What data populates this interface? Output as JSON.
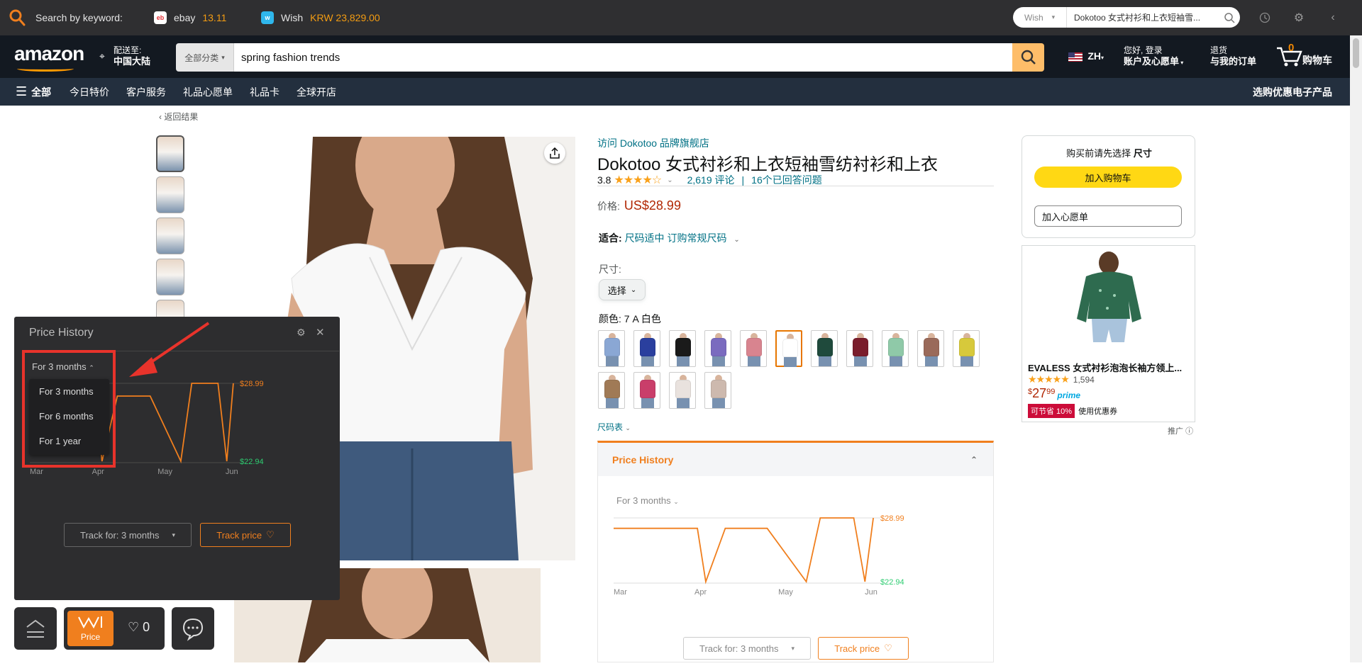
{
  "ext_bar": {
    "search_label": "Search by keyword:",
    "ebay": {
      "name": "ebay",
      "price": "13.11"
    },
    "wish": {
      "name": "Wish",
      "price": "KRW 23,829.00"
    },
    "search": {
      "select": "Wish",
      "query": "Dokotoo 女式衬衫和上衣短袖雪..."
    }
  },
  "header": {
    "logo": "amazon",
    "deliver_line1": "配送至:",
    "deliver_line2": "中国大陆",
    "search_category": "全部分类",
    "search_query": "spring fashion trends",
    "lang": "ZH",
    "account_line1": "您好, 登录",
    "account_line2": "账户及心愿单",
    "orders_line1": "退货",
    "orders_line2": "与我的订单",
    "cart_count": "0",
    "cart_label": "购物车"
  },
  "subnav": {
    "all": "全部",
    "items": [
      "今日特价",
      "客户服务",
      "礼品心愿单",
      "礼品卡",
      "全球开店"
    ],
    "right": "选购优惠电子产品"
  },
  "breadcrumb": "‹ 返回结果",
  "product": {
    "brand_link": "访问 Dokotoo 品牌旗舰店",
    "title": "Dokotoo 女式衬衫和上衣短袖雪纺衬衫和上衣",
    "rating": "3.8",
    "reviews": "2,619 评论",
    "answered": "16个已回答问题",
    "price_label": "价格:",
    "price": "US$28.99",
    "fit_label": "适合:",
    "fit_value": "尺码适中 订购常规尺码",
    "size_label": "尺寸:",
    "size_select": "选择",
    "color_label": "颜色: 7 A 白色",
    "size_chart": "尺码表",
    "swatch_colors": [
      "#8aa7d4",
      "#2a3f9e",
      "#1a1a1a",
      "#7a6bbf",
      "#d8848f",
      "#ffffff",
      "#1f4a3c",
      "#7a1d2c",
      "#8fc9a8",
      "#9a6a5a",
      "#d7c93b",
      "#a07a56",
      "#c93e6a",
      "#e9e2de",
      "#cdb9ae"
    ]
  },
  "buybox": {
    "prompt_prefix": "购买前请先选择",
    "prompt_bold": "尺寸",
    "add_cart": "加入购物车",
    "add_wishlist": "加入心愿单"
  },
  "ad": {
    "title": "EVALESS 女式衬衫泡泡长袖方领上...",
    "rating_count": "1,594",
    "price_symbol": "$",
    "price_whole": "27",
    "price_frac": "99",
    "prime": "prime",
    "coupon_badge": "可节省 10%",
    "coupon_text": "使用优惠券",
    "sponsored": "推广"
  },
  "price_history_inline": {
    "header": "Price History",
    "range": "For 3 months",
    "max_label": "$28.99",
    "min_label": "$22.94",
    "months": [
      "Mar",
      "Apr",
      "May",
      "Jun"
    ],
    "track_for": "Track for: 3 months",
    "track_price": "Track price"
  },
  "price_history_panel": {
    "title": "Price History",
    "range": "For 3 months",
    "options": [
      "For 3 months",
      "For 6 months",
      "For 1 year"
    ],
    "max_label": "$28.99",
    "min_label": "$22.94",
    "months": [
      "Mar",
      "Apr",
      "May",
      "Jun"
    ],
    "track_for": "Track for: 3 months",
    "track_price": "Track price"
  },
  "dock": {
    "price_label": "Price",
    "wishlist_count": "0"
  },
  "colors": {
    "accent_orange": "#f07f1e",
    "amazon_navy": "#131921",
    "amazon_subnav": "#232f3e",
    "price_red": "#b12704",
    "link": "#007185",
    "min_green": "#2ecc71"
  },
  "chart_data": [
    {
      "type": "line",
      "title": "Price History",
      "x": [
        "Mar",
        "Apr",
        "May",
        "Jun"
      ],
      "series": [
        {
          "values_desc": "step-like price over 3 months",
          "points": [
            [
              "Mar 1",
              28.0
            ],
            [
              "Mar 31",
              28.0
            ],
            [
              "Apr 3",
              22.94
            ],
            [
              "Apr 10",
              28.0
            ],
            [
              "Apr 25",
              28.0
            ],
            [
              "May 9",
              22.94
            ],
            [
              "May 14",
              28.99
            ],
            [
              "May 26",
              28.99
            ],
            [
              "May 30",
              22.94
            ],
            [
              "Jun 2",
              28.99
            ]
          ]
        }
      ],
      "ylim": [
        22.94,
        28.99
      ],
      "annotations": [
        "$28.99",
        "$22.94"
      ]
    }
  ]
}
